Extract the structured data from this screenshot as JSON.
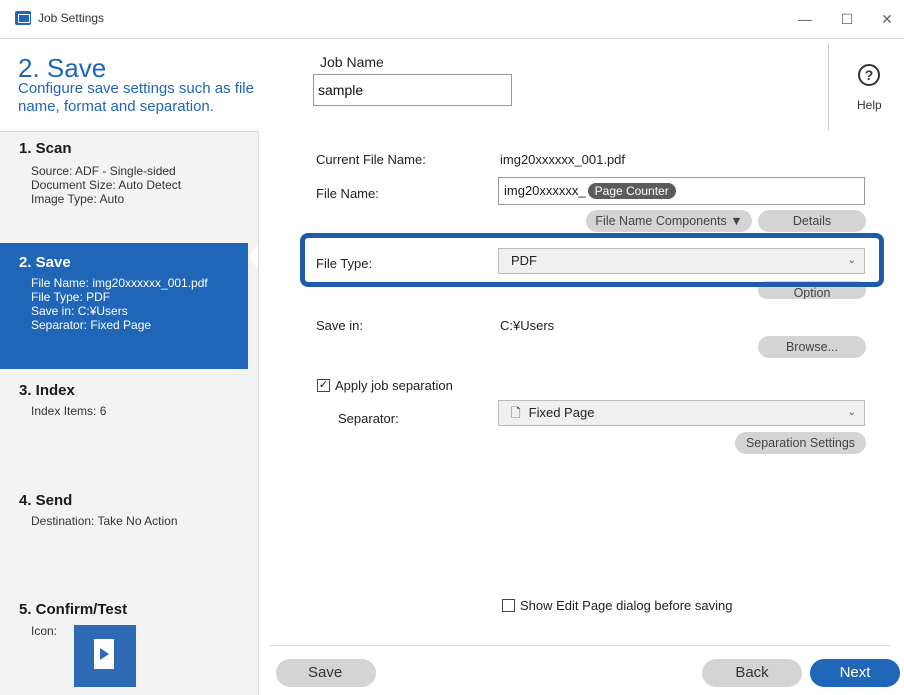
{
  "window": {
    "title": "Job Settings",
    "controls": [
      "—",
      "☐",
      "✕"
    ]
  },
  "header": {
    "step_title": "2. Save",
    "step_desc": "Configure save settings such as file name, format and separation.",
    "job_name_label": "Job Name",
    "job_name_value": "sample",
    "help_icon": "?",
    "help_label": "Help"
  },
  "sidebar": {
    "steps": [
      {
        "title": "1. Scan",
        "details": [
          "Source: ADF - Single-sided",
          "Document Size: Auto Detect",
          "Image Type: Auto"
        ]
      },
      {
        "title": "2. Save",
        "details": [
          "File Name: img20xxxxxx_001.pdf",
          "File Type: PDF",
          "Save in: C:¥Users",
          "Separator: Fixed Page"
        ]
      },
      {
        "title": "3. Index",
        "details": [
          "Index Items: 6"
        ]
      },
      {
        "title": "4. Send",
        "details": [
          "Destination: Take No Action"
        ]
      },
      {
        "title": "5. Confirm/Test",
        "details": [
          "Icon:"
        ]
      }
    ]
  },
  "main": {
    "current_file_name_label": "Current File Name:",
    "current_file_name_value": "img20xxxxxx_001.pdf",
    "file_name_label": "File Name:",
    "file_name_prefix": "img20xxxxxx_",
    "file_name_tag": "Page Counter",
    "file_name_components_btn": "File Name Components ▼",
    "details_btn": "Details",
    "file_type_label": "File Type:",
    "file_type_value": "PDF",
    "options_btn_partial": "Option",
    "save_in_label": "Save in:",
    "save_in_value": "C:¥Users",
    "browse_btn": "Browse...",
    "apply_separation_label": "Apply job separation",
    "separator_label": "Separator:",
    "separator_value": "Fixed Page",
    "separation_settings_btn": "Separation Settings",
    "show_edit_page_label": "Show Edit Page dialog before saving"
  },
  "footer": {
    "save_btn": "Save",
    "back_btn": "Back",
    "next_btn": "Next"
  },
  "colors": {
    "accent": "#1f66b8",
    "highlight_border": "#1f5ca8",
    "next_btn": "#1f66b8"
  }
}
